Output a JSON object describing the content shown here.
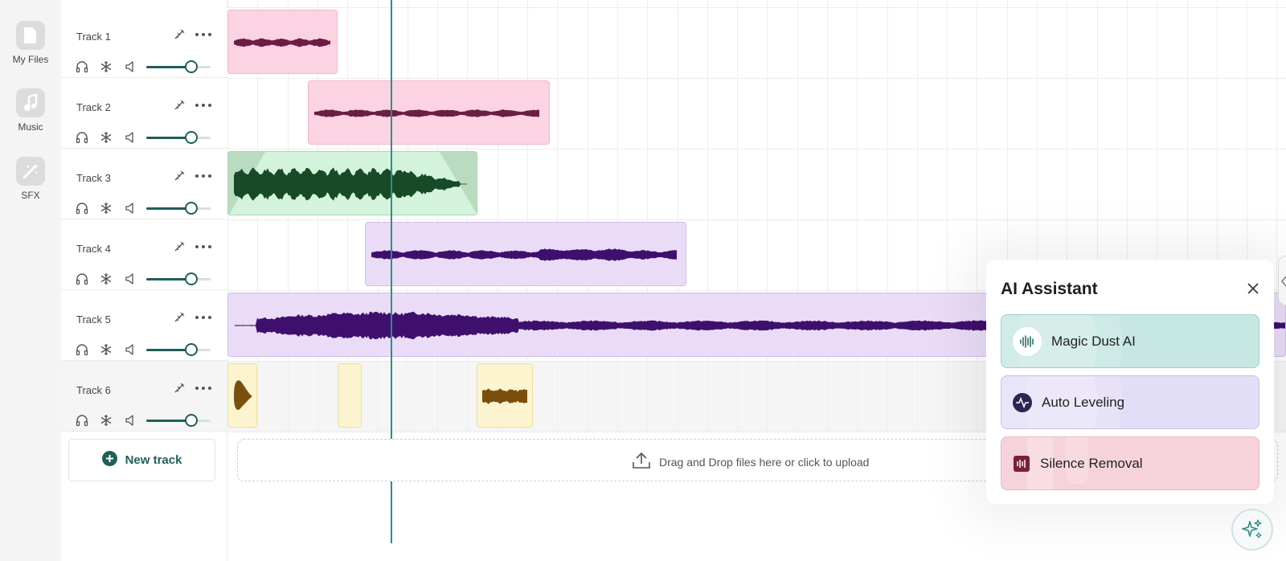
{
  "sidebar": {
    "items": [
      {
        "label": "My Files",
        "icon": "file-icon"
      },
      {
        "label": "Music",
        "icon": "music-note-icon"
      },
      {
        "label": "SFX",
        "icon": "magic-wand-icon"
      }
    ]
  },
  "tracks": [
    {
      "name": "Track 1",
      "volume": 0.7,
      "color": "#fbd3e2",
      "wave": "#6b1d44"
    },
    {
      "name": "Track 2",
      "volume": 0.7,
      "color": "#fbd3e2",
      "wave": "#6b1d44"
    },
    {
      "name": "Track 3",
      "volume": 0.7,
      "color": "#d4f3dc",
      "wave": "#174a27"
    },
    {
      "name": "Track 4",
      "volume": 0.7,
      "color": "#eadcf6",
      "wave": "#3f0f6e"
    },
    {
      "name": "Track 5",
      "volume": 0.7,
      "color": "#eadcf6",
      "wave": "#3f0f6e"
    },
    {
      "name": "Track 6",
      "volume": 0.7,
      "color": "#fbf4cf",
      "wave": "#7a4f0e",
      "selected": true
    }
  ],
  "actions": {
    "new_track": "New track",
    "drop_zone": "Drag and Drop files here or click to upload"
  },
  "ai_assistant": {
    "title": "AI Assistant",
    "options": [
      {
        "label": "Magic Dust AI",
        "color": "#c7e7e3",
        "border": "#9ed1cb",
        "icon": "magic-dust-icon"
      },
      {
        "label": "Auto Leveling",
        "color": "#e3def7",
        "border": "#c8c0ee",
        "icon": "auto-leveling-icon"
      },
      {
        "label": "Silence Removal",
        "color": "#f6d3da",
        "border": "#ecb8c2",
        "icon": "silence-removal-icon"
      }
    ]
  },
  "colors": {
    "accent": "#1f5f58",
    "playhead": "#2a8f86"
  }
}
